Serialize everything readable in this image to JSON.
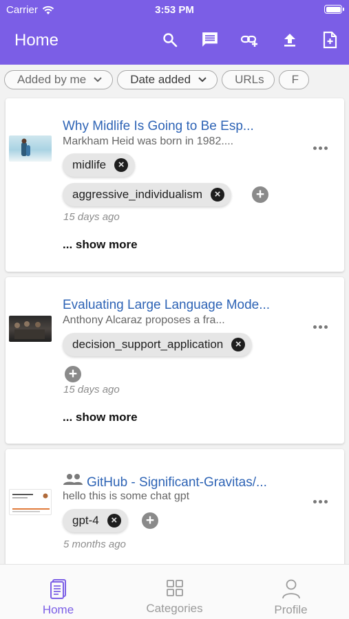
{
  "status_bar": {
    "carrier": "Carrier",
    "time": "3:53 PM"
  },
  "app_bar": {
    "title": "Home",
    "actions": [
      "search-icon",
      "message-icon",
      "add-link-icon",
      "upload-icon",
      "new-document-icon"
    ]
  },
  "filters": [
    {
      "label": "Added by me",
      "has_dropdown": true
    },
    {
      "label": "Date added",
      "has_dropdown": true
    },
    {
      "label": "URLs",
      "has_dropdown": false
    },
    {
      "label": "F",
      "has_dropdown": false
    }
  ],
  "cards": [
    {
      "title": "Why Midlife Is Going to Be Esp...",
      "subtitle": "Markham Heid was born in 1982....",
      "tags": [
        "midlife",
        "aggressive_individualism"
      ],
      "date": "15 days ago",
      "show_more": "... show more",
      "shared": false
    },
    {
      "title": "Evaluating Large Language Mode...",
      "subtitle": "Anthony Alcaraz proposes a fra...",
      "tags": [
        "decision_support_application"
      ],
      "date": "15 days ago",
      "show_more": "... show more",
      "shared": false
    },
    {
      "title": "GitHub - Significant-Gravitas/...",
      "subtitle": "hello this is some chat gpt",
      "tags": [
        "gpt-4"
      ],
      "date": "5 months ago",
      "shared": true
    }
  ],
  "bottom_nav": [
    {
      "label": "Home",
      "icon": "document-icon",
      "active": true
    },
    {
      "label": "Categories",
      "icon": "grid-icon",
      "active": false
    },
    {
      "label": "Profile",
      "icon": "person-icon",
      "active": false
    }
  ],
  "colors": {
    "primary": "#7b5ee6",
    "link": "#2d63b5",
    "tag_bg": "#e6e6e6"
  }
}
